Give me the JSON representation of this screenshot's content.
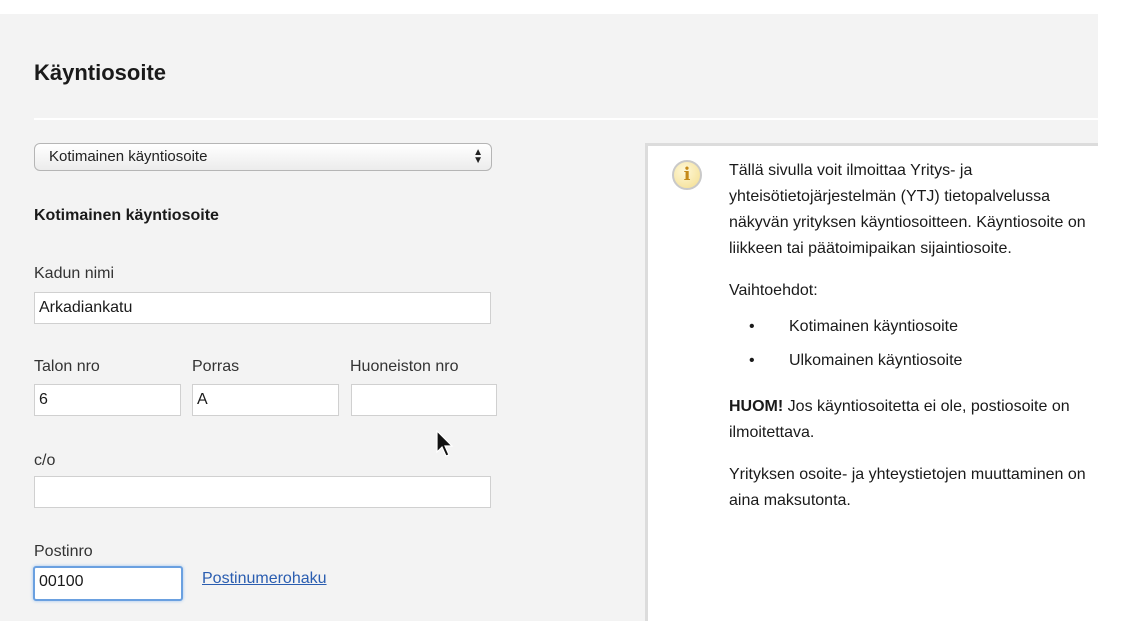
{
  "page": {
    "title": "Käyntiosoite"
  },
  "address_type": {
    "selected": "Kotimainen käyntiosoite",
    "arrow_glyph": "▲▼"
  },
  "form": {
    "section_heading": "Kotimainen käyntiosoite",
    "street": {
      "label": "Kadun nimi",
      "value": "Arkadiankatu"
    },
    "house_no": {
      "label": "Talon nro",
      "value": "6"
    },
    "stairway": {
      "label": "Porras",
      "value": "A"
    },
    "apartment_no": {
      "label": "Huoneiston nro",
      "value": ""
    },
    "care_of": {
      "label": "c/o",
      "value": ""
    },
    "postal_code": {
      "label": "Postinro",
      "value": "00100"
    },
    "postal_lookup_link": "Postinumerohaku"
  },
  "info_panel": {
    "icon": "info-icon",
    "icon_glyph": "i",
    "intro": "Tällä sivulla voit ilmoittaa Yritys- ja yhteisötietojärjestelmän (YTJ) tietopalvelussa näkyvän yrityksen käyntiosoitteen. Käyntiosoite on liikkeen tai päätoimipaikan sijaintiosoite.",
    "options_heading": "Vaihtoehdot:",
    "options": [
      "Kotimainen käyntiosoite",
      "Ulkomainen käyntiosoite"
    ],
    "note_bold": "HUOM!",
    "note_text": " Jos käyntiosoitetta ei ole, postiosoite on ilmoitettava.",
    "free_of_charge": "Yrityksen osoite- ja yhteystietojen muuttaminen on aina maksutonta."
  },
  "colors": {
    "background": "#f3f3f3",
    "link": "#2a5db0",
    "focus_ring": "#6aa0e0",
    "icon_fill": "#f3dd8e"
  }
}
